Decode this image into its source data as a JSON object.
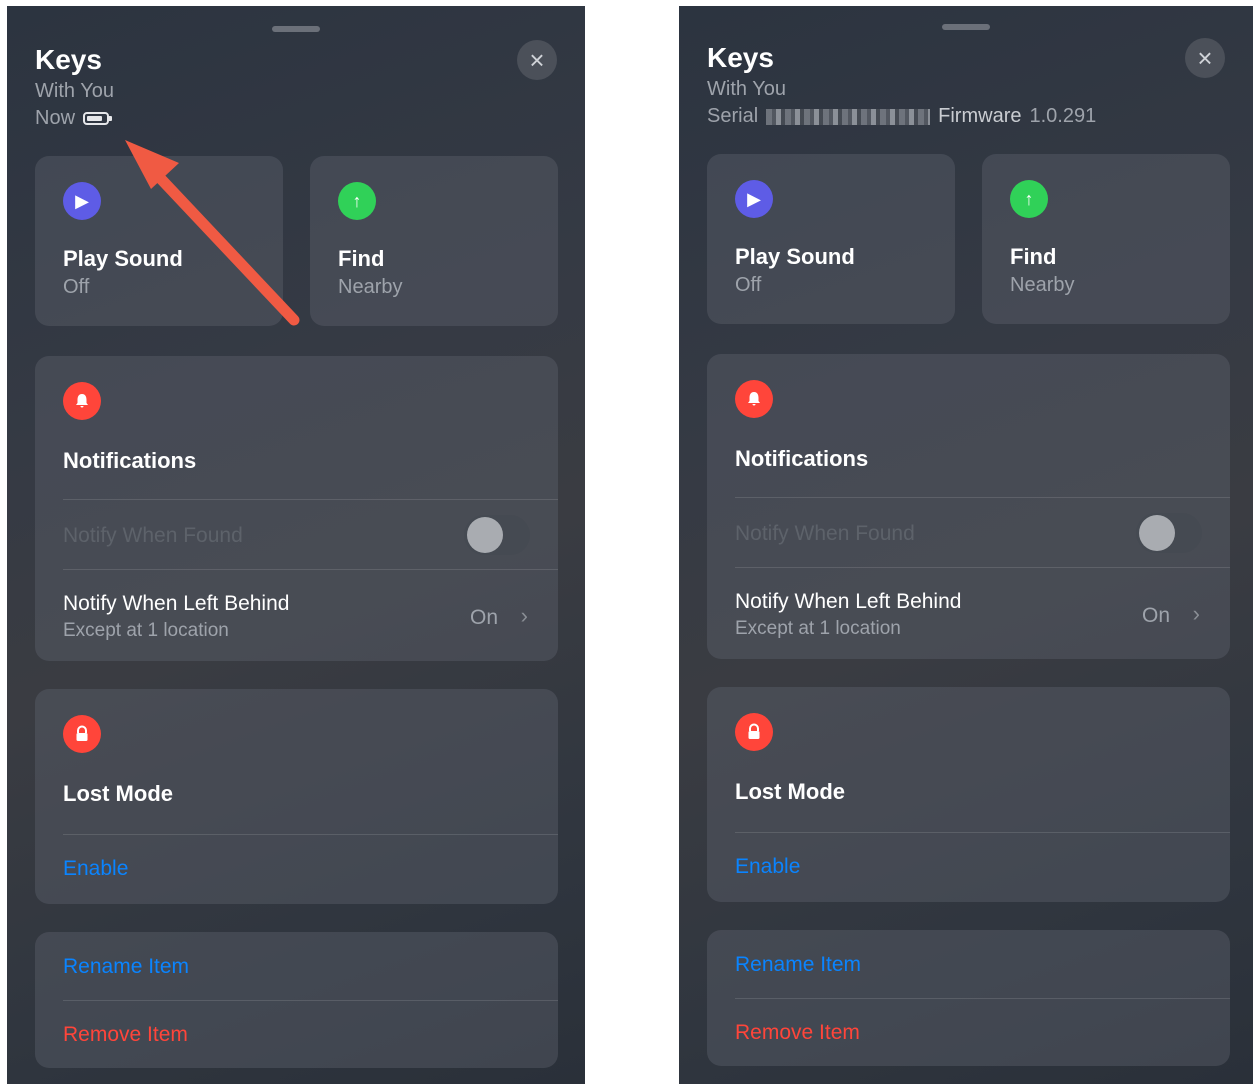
{
  "left": {
    "title": "Keys",
    "subtitle": "With You",
    "status_time": "Now",
    "close_icon": "×",
    "play_sound": {
      "label": "Play Sound",
      "status": "Off",
      "icon": "▶"
    },
    "find_nearby": {
      "label": "Find",
      "status": "Nearby",
      "icon": "↑"
    },
    "notifications": {
      "title": "Notifications",
      "icon": "bell",
      "notify_found": "Notify When Found",
      "notify_left": "Notify When Left Behind",
      "notify_left_sub": "Except at 1 location",
      "notify_left_value": "On",
      "chevron": "›"
    },
    "lost_mode": {
      "title": "Lost Mode",
      "icon": "lock",
      "enable": "Enable"
    },
    "actions": {
      "rename": "Rename Item",
      "remove": "Remove Item"
    }
  },
  "right": {
    "title": "Keys",
    "subtitle": "With You",
    "serial_label": "Serial",
    "firmware_label": "Firmware",
    "firmware_value": "1.0.291",
    "close_icon": "×",
    "play_sound": {
      "label": "Play Sound",
      "status": "Off",
      "icon": "▶"
    },
    "find_nearby": {
      "label": "Find",
      "status": "Nearby",
      "icon": "↑"
    },
    "notifications": {
      "title": "Notifications",
      "icon": "bell",
      "notify_found": "Notify When Found",
      "notify_left": "Notify When Left Behind",
      "notify_left_sub": "Except at 1 location",
      "notify_left_value": "On",
      "chevron": "›"
    },
    "lost_mode": {
      "title": "Lost Mode",
      "icon": "lock",
      "enable": "Enable"
    },
    "actions": {
      "rename": "Rename Item",
      "remove": "Remove Item"
    }
  },
  "annotation": {
    "arrow_color": "#f05a43"
  },
  "colors": {
    "purple": "#5e5ce6",
    "green": "#30d158",
    "red": "#ff453a",
    "blue": "#0a84ff"
  }
}
